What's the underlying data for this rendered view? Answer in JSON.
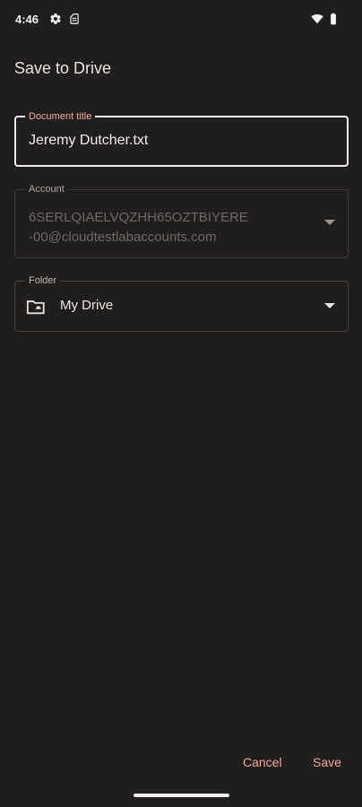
{
  "status_bar": {
    "time": "4:46",
    "icons": [
      "settings-icon",
      "sim-card-icon",
      "wifi-icon",
      "battery-icon"
    ]
  },
  "dialog": {
    "title": "Save to Drive",
    "document_title": {
      "label": "Document title",
      "value": "Jeremy Dutcher.txt"
    },
    "account": {
      "label": "Account",
      "value_line1": "6SERLQIAELVQZHH65OZTBIYERE",
      "value_line2": "-00@cloudtestlabaccounts.com"
    },
    "folder": {
      "label": "Folder",
      "value": "My Drive"
    },
    "actions": {
      "cancel": "Cancel",
      "save": "Save"
    }
  },
  "colors": {
    "background": "#211e1e",
    "accent": "#f0a89e",
    "text": "#e9e2e1"
  }
}
